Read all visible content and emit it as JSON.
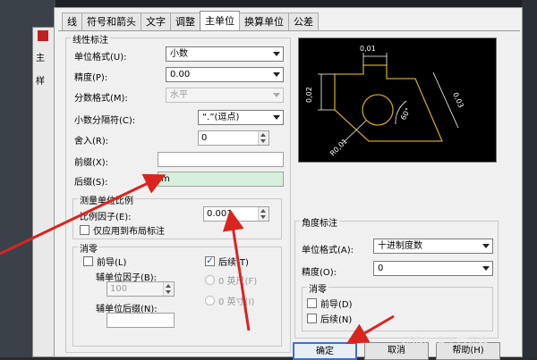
{
  "tabs": [
    "线",
    "符号和箭头",
    "文字",
    "调整",
    "主单位",
    "换算单位",
    "公差"
  ],
  "active_tab": "主单位",
  "background": {
    "label1": "主",
    "label2": "样"
  },
  "linear": {
    "title": "线性标注",
    "unit_format_label": "单位格式(U):",
    "unit_format_value": "小数",
    "precision_label": "精度(P):",
    "precision_value": "0.00",
    "fraction_format_label": "分数格式(M):",
    "fraction_format_value": "水平",
    "decimal_sep_label": "小数分隔符(C):",
    "decimal_sep_value": "“.”(逗点)",
    "round_label": "舍入(R):",
    "round_value": "0",
    "prefix_label": "前缀(X):",
    "prefix_value": "",
    "suffix_label": "后缀(S):",
    "suffix_value": "m"
  },
  "scale": {
    "title": "测量单位比例",
    "factor_label": "比例因子(E):",
    "factor_value": "0.001",
    "layout_only_label": "仅应用到布局标注"
  },
  "zero_suppress": {
    "title": "消零",
    "leading_label": "前导(L)",
    "sub_unit_factor_label": "辅单位因子(B):",
    "sub_unit_factor_value": "100",
    "sub_unit_suffix_label": "辅单位后缀(N):",
    "sub_unit_suffix_value": "",
    "trailing_label": "后续(T)",
    "trailing_checked": "✓",
    "feet_label": "0 英尺(F)",
    "inches_label": "0 英寸(I)"
  },
  "preview": {
    "dim_top": "0,01",
    "dim_left": "0,02",
    "dim_right": "0,03",
    "dim_angle": "60°",
    "dim_radius": "R0,01"
  },
  "angular": {
    "title": "角度标注",
    "unit_format_label": "单位格式(A):",
    "unit_format_value": "十进制度数",
    "precision_label": "精度(O):",
    "precision_value": "0",
    "zero_title": "消零",
    "leading_label": "前导(D)",
    "trailing_label": "后续(N)"
  },
  "buttons": {
    "ok": "确定",
    "cancel": "取消",
    "help": "帮助(H)"
  },
  "watermark": "CSDN @十六先森",
  "colors": {
    "suffix_highlight": "#d6f0dd",
    "arrow": "#d9241f",
    "preview_line": "#c9a227",
    "preview_dim": "#ffffff"
  }
}
